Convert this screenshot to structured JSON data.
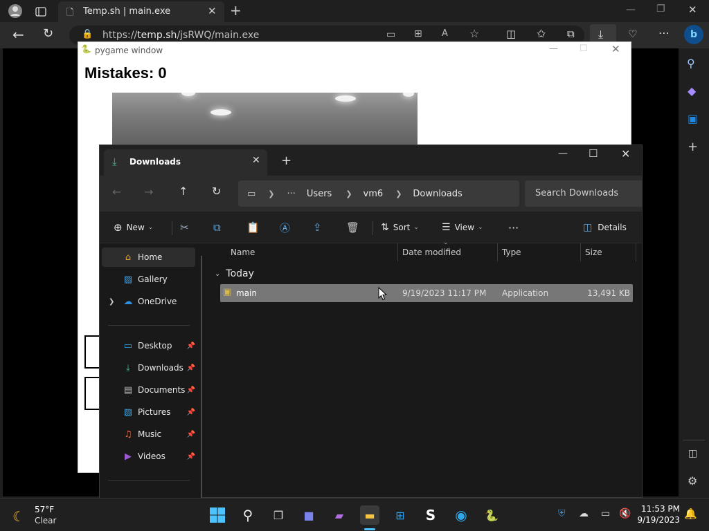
{
  "browser": {
    "tab_title": "Temp.sh | main.exe",
    "url_prefix": "https://",
    "url_host": "temp.sh",
    "url_path": "/jsRWQ/main.exe"
  },
  "pygame": {
    "window_title": "pygame window",
    "mistakes_text": "Mistakes: 0"
  },
  "explorer": {
    "tab_label": "Downloads",
    "breadcrumb": [
      "Users",
      "vm6",
      "Downloads"
    ],
    "search_placeholder": "Search Downloads",
    "commands": {
      "new": "New",
      "sort": "Sort",
      "view": "View",
      "details": "Details"
    },
    "sidebar": [
      {
        "label": "Home"
      },
      {
        "label": "Gallery"
      },
      {
        "label": "OneDrive"
      },
      {
        "label": "Desktop"
      },
      {
        "label": "Downloads"
      },
      {
        "label": "Documents"
      },
      {
        "label": "Pictures"
      },
      {
        "label": "Music"
      },
      {
        "label": "Videos"
      }
    ],
    "columns": [
      "Name",
      "Date modified",
      "Type",
      "Size"
    ],
    "group": "Today",
    "file": {
      "name": "main",
      "date": "9/19/2023 11:17 PM",
      "type": "Application",
      "size": "13,491 KB"
    }
  },
  "taskbar": {
    "weather_temp": "57°F",
    "weather_desc": "Clear",
    "time": "11:53 PM",
    "date": "9/19/2023"
  }
}
